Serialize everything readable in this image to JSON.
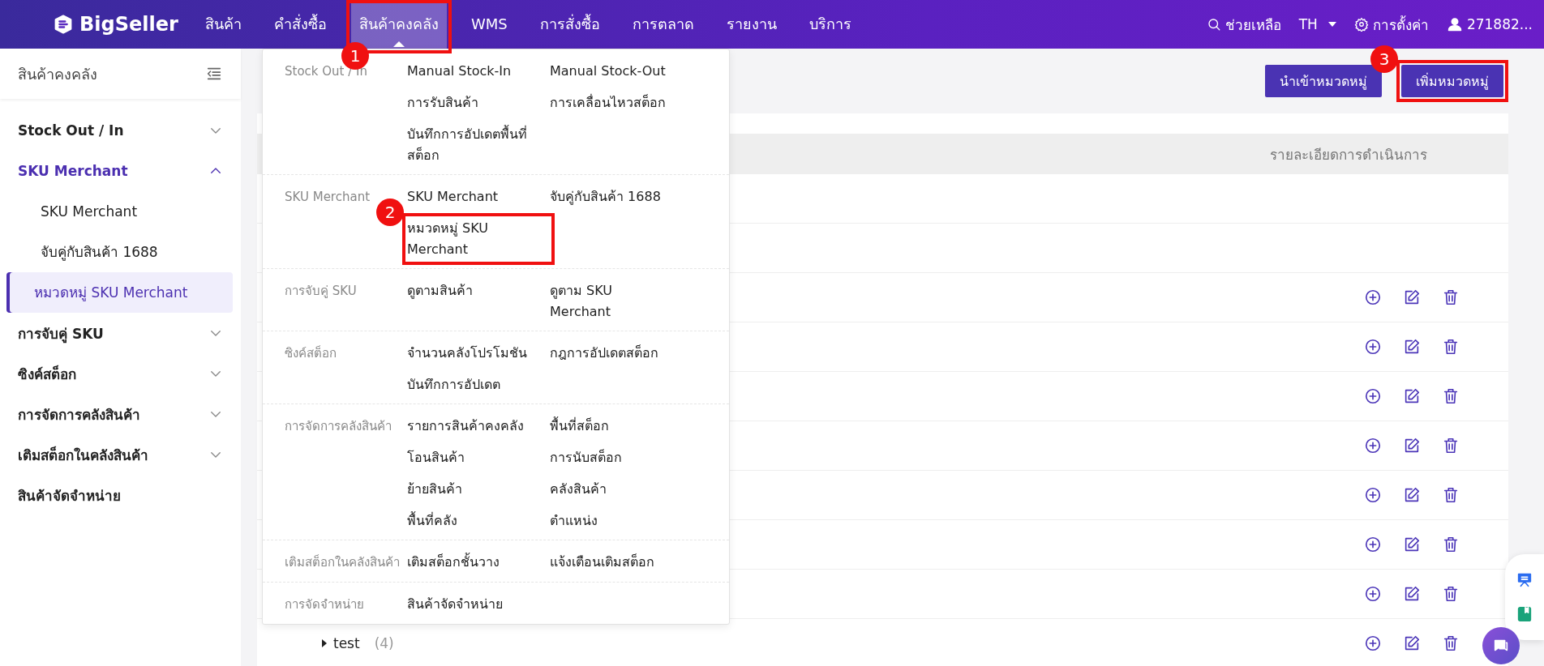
{
  "topbar": {
    "logo": "BigSeller",
    "nav": [
      {
        "label": "สินค้า",
        "selected": false
      },
      {
        "label": "คำสั่งซื้อ",
        "selected": false
      },
      {
        "label": "สินค้าคงคลัง",
        "selected": true,
        "annotation": "1"
      },
      {
        "label": "WMS",
        "selected": false
      },
      {
        "label": "การสั่งซื้อ",
        "selected": false
      },
      {
        "label": "การตลาด",
        "selected": false
      },
      {
        "label": "รายงาน",
        "selected": false
      },
      {
        "label": "บริการ",
        "selected": false
      }
    ],
    "help": "ช่วยเหลือ",
    "language": "TH",
    "settings": "การตั้งค่า",
    "user": "271882..."
  },
  "sidebar": {
    "title": "สินค้าคงคลัง",
    "items": [
      {
        "label": "Stock Out / In",
        "kind": "group",
        "expanded": false
      },
      {
        "label": "SKU Merchant",
        "kind": "group",
        "expanded": true,
        "children": [
          {
            "label": "SKU Merchant",
            "selected": false
          },
          {
            "label": "จับคู่กับสินค้า 1688",
            "selected": false
          },
          {
            "label": "หมวดหมู่ SKU Merchant",
            "selected": true
          }
        ]
      },
      {
        "label": "การจับคู่ SKU",
        "kind": "group",
        "expanded": false
      },
      {
        "label": "ซิงค์สต็อก",
        "kind": "group",
        "expanded": false
      },
      {
        "label": "การจัดการคลังสินค้า",
        "kind": "group",
        "expanded": false
      },
      {
        "label": "เติมสต็อกในคลังสินค้า",
        "kind": "group",
        "expanded": false
      },
      {
        "label": "สินค้าจัดจำหน่าย",
        "kind": "link"
      }
    ]
  },
  "toolbar": {
    "buttons": [
      {
        "label": "นำเข้าหมวดหมู่"
      },
      {
        "label": "เพิ่มหมวดหมู่",
        "annotation": "3"
      }
    ]
  },
  "table": {
    "column_header": "รายละเอียดการดำเนินการ",
    "rows": [
      {
        "actions": false
      },
      {
        "actions": false
      },
      {
        "actions": true
      },
      {
        "actions": true
      },
      {
        "actions": true
      },
      {
        "actions": true
      },
      {
        "actions": true
      },
      {
        "actions": true
      },
      {
        "actions": true
      },
      {
        "actions": true,
        "name": "test",
        "count": "(4)"
      }
    ]
  },
  "dropdown": {
    "groups": [
      {
        "label": "Stock Out / In",
        "links": [
          "Manual Stock-In",
          "Manual Stock-Out",
          "การรับสินค้า",
          "การเคลื่อนไหวสต็อก",
          "บันทึกการอัปเดตพื้นที่สต็อก"
        ]
      },
      {
        "label": "SKU Merchant",
        "links": [
          "SKU Merchant",
          "จับคู่กับสินค้า 1688",
          {
            "label": "หมวดหมู่ SKU Merchant",
            "annotation": "2"
          }
        ]
      },
      {
        "label": "การจับคู่ SKU",
        "links": [
          "ดูตามสินค้า",
          "ดูตาม SKU Merchant"
        ]
      },
      {
        "label": "ซิงค์สต็อก",
        "links": [
          "จำนวนคลังโปรโมชัน",
          "กฎการอัปเดตสต็อก",
          "บันทึกการอัปเดต"
        ]
      },
      {
        "label": "การจัดการคลังสินค้า",
        "links": [
          "รายการสินค้าคงคลัง",
          "พื้นที่สต็อก",
          "โอนสินค้า",
          "การนับสต็อก",
          "ย้ายสินค้า",
          "คลังสินค้า",
          "พื้นที่คลัง",
          "ตำแหน่ง"
        ]
      },
      {
        "label": "เติมสต็อกในคลังสินค้า",
        "links": [
          "เติมสต็อกชั้นวาง",
          "แจ้งเตือนเติมสต็อก"
        ]
      },
      {
        "label": "การจัดจำหน่าย",
        "links": [
          "สินค้าจัดจำหน่าย"
        ]
      }
    ]
  }
}
